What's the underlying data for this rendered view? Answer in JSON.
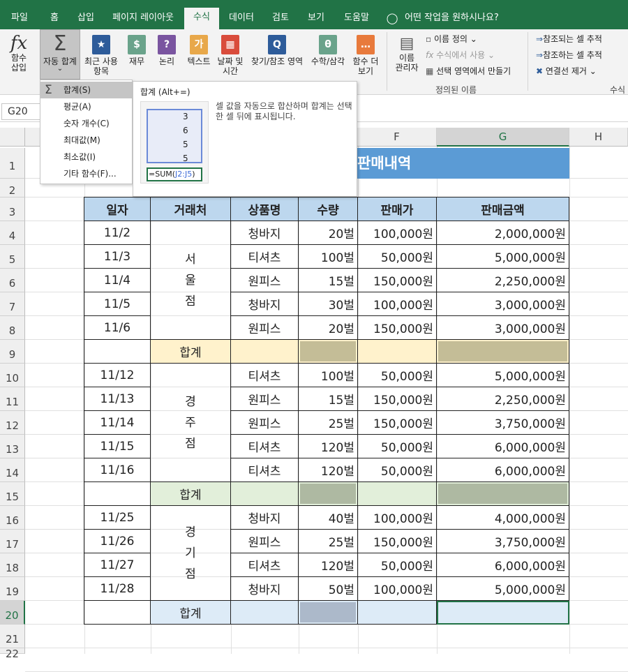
{
  "menu": {
    "tabs": [
      "파일",
      "홈",
      "삽입",
      "페이지 레이아웃",
      "수식",
      "데이터",
      "검토",
      "보기",
      "도움말"
    ],
    "active_tab": "수식",
    "tell_me": "어떤 작업을 원하시나요?"
  },
  "ribbon": {
    "insert_function": [
      "함수",
      "삽입"
    ],
    "autosum": [
      "자동 합계"
    ],
    "recent": [
      "최근 사용",
      "항목"
    ],
    "financial": [
      "재무"
    ],
    "logical": [
      "논리"
    ],
    "text": [
      "텍스트"
    ],
    "datetime": [
      "날짜 및",
      "시간"
    ],
    "lookup": [
      "찾기/참조 영역"
    ],
    "math": [
      "수학/삼각"
    ],
    "more": [
      "함수 더",
      "보기"
    ],
    "name_manager": [
      "이름",
      "관리자"
    ],
    "define_name": "이름 정의",
    "use_in_formula": "수식에서 사용",
    "create_from_selection": "선택 영역에서 만들기",
    "defined_names_group": "정의된 이름",
    "trace_precedents": "참조되는 셀 추적",
    "trace_dependents": "참조하는 셀 추적",
    "remove_arrows": "연결선 제거",
    "formula_auditing_group": "수식"
  },
  "icons": {
    "fx": "fx",
    "sigma": "Σ",
    "financial_glyph": "$",
    "logical_glyph": "?",
    "text_glyph": "가",
    "lookup_glyph": "Q",
    "math_glyph": "θ",
    "more_glyph": "…",
    "chevron": "⌄"
  },
  "name_box": "G20",
  "dropdown": {
    "items": [
      "합계(S)",
      "평균(A)",
      "숫자 개수(C)",
      "최대값(M)",
      "최소값(I)",
      "기타 함수(F)..."
    ]
  },
  "tooltip": {
    "title": "합계 (Alt+=)",
    "description": "셀 값을 자동으로 합산하며 합계는 선택한 셀 뒤에 표시됩니다.",
    "preview_values": [
      "3",
      "6",
      "5",
      "5"
    ],
    "preview_formula_prefix": "=SUM(",
    "preview_formula_ref": "J2:J5",
    "preview_formula_suffix": ")"
  },
  "columns": [
    "F",
    "G",
    "H"
  ],
  "rows": [
    "1",
    "2",
    "3",
    "4",
    "5",
    "6",
    "7",
    "8",
    "9",
    "10",
    "11",
    "12",
    "13",
    "14",
    "15",
    "16",
    "17",
    "18",
    "19",
    "20",
    "21",
    "22"
  ],
  "sheet": {
    "title": "판매내역",
    "headers": [
      "일자",
      "거래처",
      "상품명",
      "수량",
      "판매가",
      "판매금액"
    ],
    "subtotal_label": "합계",
    "groups": [
      {
        "region": [
          "서",
          "울",
          "점"
        ],
        "rows": [
          {
            "date": "11/2",
            "product": "청바지",
            "qty": "20벌",
            "price": "100,000원",
            "amount": "2,000,000원"
          },
          {
            "date": "11/3",
            "product": "티셔츠",
            "qty": "100벌",
            "price": "50,000원",
            "amount": "5,000,000원"
          },
          {
            "date": "11/4",
            "product": "원피스",
            "qty": "15벌",
            "price": "150,000원",
            "amount": "2,250,000원"
          },
          {
            "date": "11/5",
            "product": "청바지",
            "qty": "30벌",
            "price": "100,000원",
            "amount": "3,000,000원"
          },
          {
            "date": "11/6",
            "product": "원피스",
            "qty": "20벌",
            "price": "150,000원",
            "amount": "3,000,000원"
          }
        ]
      },
      {
        "region": [
          "경",
          "주",
          "점"
        ],
        "rows": [
          {
            "date": "11/12",
            "product": "티셔츠",
            "qty": "100벌",
            "price": "50,000원",
            "amount": "5,000,000원"
          },
          {
            "date": "11/13",
            "product": "원피스",
            "qty": "15벌",
            "price": "150,000원",
            "amount": "2,250,000원"
          },
          {
            "date": "11/14",
            "product": "원피스",
            "qty": "25벌",
            "price": "150,000원",
            "amount": "3,750,000원"
          },
          {
            "date": "11/15",
            "product": "티셔츠",
            "qty": "120벌",
            "price": "50,000원",
            "amount": "6,000,000원"
          },
          {
            "date": "11/16",
            "product": "티셔츠",
            "qty": "120벌",
            "price": "50,000원",
            "amount": "6,000,000원"
          }
        ]
      },
      {
        "region": [
          "경",
          "기",
          "점"
        ],
        "rows": [
          {
            "date": "11/25",
            "product": "청바지",
            "qty": "40벌",
            "price": "100,000원",
            "amount": "4,000,000원"
          },
          {
            "date": "11/26",
            "product": "원피스",
            "qty": "25벌",
            "price": "150,000원",
            "amount": "3,750,000원"
          },
          {
            "date": "11/27",
            "product": "티셔츠",
            "qty": "120벌",
            "price": "50,000원",
            "amount": "6,000,000원"
          },
          {
            "date": "11/28",
            "product": "청바지",
            "qty": "50벌",
            "price": "100,000원",
            "amount": "5,000,000원"
          }
        ]
      }
    ]
  },
  "colors": {
    "excel_green": "#217346",
    "header_fill": "#bdd7ee",
    "title_fill": "#5b9bd5",
    "subtotal1_light": "#fff2cc",
    "subtotal1_dark": "#c4bd97",
    "subtotal2_light": "#e2efda",
    "subtotal2_dark": "#aeb9a2",
    "subtotal3_light": "#ddebf7",
    "subtotal3_dark": "#acb9ca"
  }
}
